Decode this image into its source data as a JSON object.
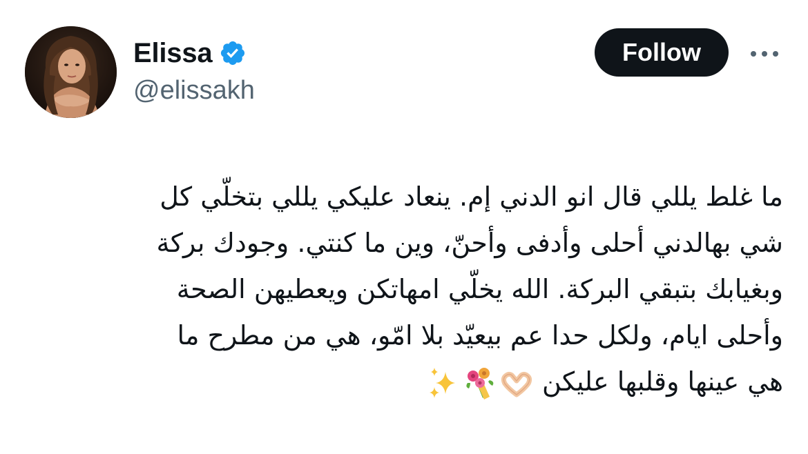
{
  "author": {
    "display_name": "Elissa",
    "handle": "@elissakh",
    "verified": true,
    "avatar_icon": "profile-photo"
  },
  "actions": {
    "follow_label": "Follow",
    "more_icon": "more-horizontal-icon"
  },
  "tweet": {
    "lines": [
      "ما غلط يللي قال انو الدني إم. ينعاد عليكي يللي بتخلّي كل",
      "شي بهالدني أحلى وأدفى وأحنّ، وين ما كنتي. وجودك بركة",
      "وبغيابك بتبقي البركة. الله يخلّي امهاتكن ويعطيهن الصحة",
      "وأحلى ايام، ولكل حدا عم بيعيّد بلا امّو، هي من مطرح ما",
      "هي عينها وقلبها عليكن"
    ],
    "emojis": [
      "heart-hands-emoji",
      "bouquet-emoji",
      "sparkles-emoji"
    ]
  },
  "colors": {
    "text_primary": "#0f1419",
    "text_secondary": "#536471",
    "verified_blue": "#1d9bf0",
    "follow_bg": "#0f1419",
    "follow_text": "#ffffff"
  }
}
